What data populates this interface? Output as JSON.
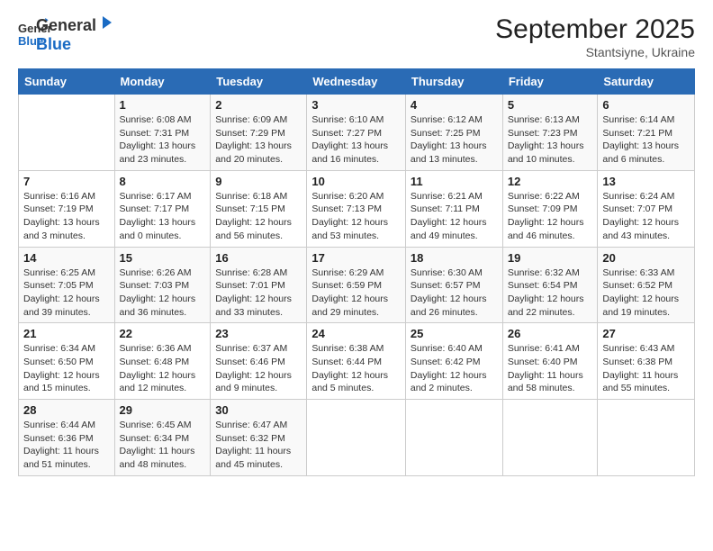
{
  "header": {
    "logo": {
      "general": "General",
      "blue": "Blue"
    },
    "title": "September 2025",
    "subtitle": "Stantsiyne, Ukraine"
  },
  "weekdays": [
    "Sunday",
    "Monday",
    "Tuesday",
    "Wednesday",
    "Thursday",
    "Friday",
    "Saturday"
  ],
  "weeks": [
    [
      {
        "day": "",
        "info": ""
      },
      {
        "day": "1",
        "info": "Sunrise: 6:08 AM\nSunset: 7:31 PM\nDaylight: 13 hours\nand 23 minutes."
      },
      {
        "day": "2",
        "info": "Sunrise: 6:09 AM\nSunset: 7:29 PM\nDaylight: 13 hours\nand 20 minutes."
      },
      {
        "day": "3",
        "info": "Sunrise: 6:10 AM\nSunset: 7:27 PM\nDaylight: 13 hours\nand 16 minutes."
      },
      {
        "day": "4",
        "info": "Sunrise: 6:12 AM\nSunset: 7:25 PM\nDaylight: 13 hours\nand 13 minutes."
      },
      {
        "day": "5",
        "info": "Sunrise: 6:13 AM\nSunset: 7:23 PM\nDaylight: 13 hours\nand 10 minutes."
      },
      {
        "day": "6",
        "info": "Sunrise: 6:14 AM\nSunset: 7:21 PM\nDaylight: 13 hours\nand 6 minutes."
      }
    ],
    [
      {
        "day": "7",
        "info": "Sunrise: 6:16 AM\nSunset: 7:19 PM\nDaylight: 13 hours\nand 3 minutes."
      },
      {
        "day": "8",
        "info": "Sunrise: 6:17 AM\nSunset: 7:17 PM\nDaylight: 13 hours\nand 0 minutes."
      },
      {
        "day": "9",
        "info": "Sunrise: 6:18 AM\nSunset: 7:15 PM\nDaylight: 12 hours\nand 56 minutes."
      },
      {
        "day": "10",
        "info": "Sunrise: 6:20 AM\nSunset: 7:13 PM\nDaylight: 12 hours\nand 53 minutes."
      },
      {
        "day": "11",
        "info": "Sunrise: 6:21 AM\nSunset: 7:11 PM\nDaylight: 12 hours\nand 49 minutes."
      },
      {
        "day": "12",
        "info": "Sunrise: 6:22 AM\nSunset: 7:09 PM\nDaylight: 12 hours\nand 46 minutes."
      },
      {
        "day": "13",
        "info": "Sunrise: 6:24 AM\nSunset: 7:07 PM\nDaylight: 12 hours\nand 43 minutes."
      }
    ],
    [
      {
        "day": "14",
        "info": "Sunrise: 6:25 AM\nSunset: 7:05 PM\nDaylight: 12 hours\nand 39 minutes."
      },
      {
        "day": "15",
        "info": "Sunrise: 6:26 AM\nSunset: 7:03 PM\nDaylight: 12 hours\nand 36 minutes."
      },
      {
        "day": "16",
        "info": "Sunrise: 6:28 AM\nSunset: 7:01 PM\nDaylight: 12 hours\nand 33 minutes."
      },
      {
        "day": "17",
        "info": "Sunrise: 6:29 AM\nSunset: 6:59 PM\nDaylight: 12 hours\nand 29 minutes."
      },
      {
        "day": "18",
        "info": "Sunrise: 6:30 AM\nSunset: 6:57 PM\nDaylight: 12 hours\nand 26 minutes."
      },
      {
        "day": "19",
        "info": "Sunrise: 6:32 AM\nSunset: 6:54 PM\nDaylight: 12 hours\nand 22 minutes."
      },
      {
        "day": "20",
        "info": "Sunrise: 6:33 AM\nSunset: 6:52 PM\nDaylight: 12 hours\nand 19 minutes."
      }
    ],
    [
      {
        "day": "21",
        "info": "Sunrise: 6:34 AM\nSunset: 6:50 PM\nDaylight: 12 hours\nand 15 minutes."
      },
      {
        "day": "22",
        "info": "Sunrise: 6:36 AM\nSunset: 6:48 PM\nDaylight: 12 hours\nand 12 minutes."
      },
      {
        "day": "23",
        "info": "Sunrise: 6:37 AM\nSunset: 6:46 PM\nDaylight: 12 hours\nand 9 minutes."
      },
      {
        "day": "24",
        "info": "Sunrise: 6:38 AM\nSunset: 6:44 PM\nDaylight: 12 hours\nand 5 minutes."
      },
      {
        "day": "25",
        "info": "Sunrise: 6:40 AM\nSunset: 6:42 PM\nDaylight: 12 hours\nand 2 minutes."
      },
      {
        "day": "26",
        "info": "Sunrise: 6:41 AM\nSunset: 6:40 PM\nDaylight: 11 hours\nand 58 minutes."
      },
      {
        "day": "27",
        "info": "Sunrise: 6:43 AM\nSunset: 6:38 PM\nDaylight: 11 hours\nand 55 minutes."
      }
    ],
    [
      {
        "day": "28",
        "info": "Sunrise: 6:44 AM\nSunset: 6:36 PM\nDaylight: 11 hours\nand 51 minutes."
      },
      {
        "day": "29",
        "info": "Sunrise: 6:45 AM\nSunset: 6:34 PM\nDaylight: 11 hours\nand 48 minutes."
      },
      {
        "day": "30",
        "info": "Sunrise: 6:47 AM\nSunset: 6:32 PM\nDaylight: 11 hours\nand 45 minutes."
      },
      {
        "day": "",
        "info": ""
      },
      {
        "day": "",
        "info": ""
      },
      {
        "day": "",
        "info": ""
      },
      {
        "day": "",
        "info": ""
      }
    ]
  ]
}
